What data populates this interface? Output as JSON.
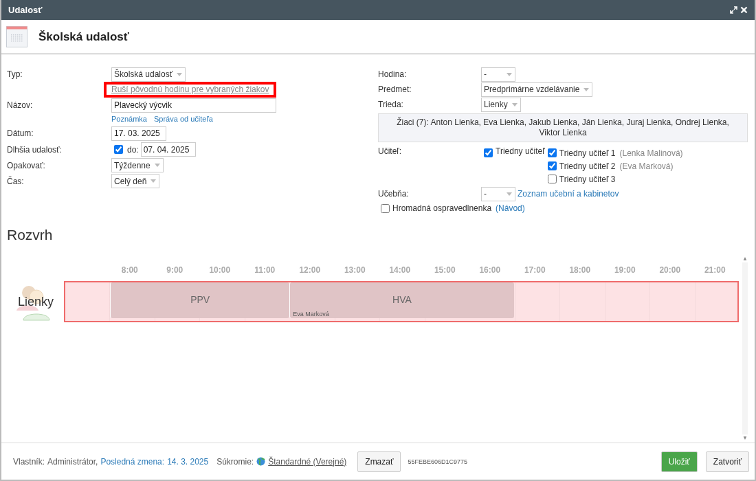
{
  "window": {
    "title": "Udalosť"
  },
  "header": {
    "title": "Školská udalosť"
  },
  "left_form": {
    "type": {
      "label": "Typ:",
      "value": "Školská udalosť",
      "note": "Ruší pôvodnú hodinu pre vybraných žiakov",
      "note_highlighted": true
    },
    "name": {
      "label": "Názov:",
      "value": "Plavecký výcvik",
      "links": [
        "Poznámka",
        "Správa od učiteľa"
      ]
    },
    "date": {
      "label": "Dátum:",
      "value": "17. 03. 2025"
    },
    "longer": {
      "label": "Dlhšia udalosť:",
      "checked": true,
      "to_label": "do:",
      "to_value": "07. 04. 2025"
    },
    "repeat": {
      "label": "Opakovať:",
      "value": "Týždenne"
    },
    "time": {
      "label": "Čas:",
      "value": "Celý deň"
    }
  },
  "right_form": {
    "lesson": {
      "label": "Hodina:",
      "value": "-"
    },
    "subject": {
      "label": "Predmet:",
      "value": "Predprimárne vzdelávanie"
    },
    "class": {
      "label": "Trieda:",
      "value": "Lienky"
    },
    "students": "Žiaci (7): Anton Lienka, Eva Lienka, Jakub Lienka, Ján Lienka, Juraj Lienka, Ondrej Lienka, Viktor Lienka",
    "teacher": {
      "label": "Učiteľ:",
      "main": {
        "label": "Triedny učiteľ",
        "checked": true
      },
      "options": [
        {
          "label": "Triedny učiteľ 1",
          "person": "(Lenka Malinová)",
          "checked": true
        },
        {
          "label": "Triedny učiteľ 2",
          "person": "(Eva Marková)",
          "checked": true
        },
        {
          "label": "Triedny učiteľ 3",
          "checked": false
        }
      ]
    },
    "room": {
      "label": "Učebňa:",
      "value": "-",
      "link": "Zoznam učební a kabinetov"
    },
    "bulk_excuse": {
      "label": "Hromadná ospravedlnenka",
      "checked": false,
      "link": "(Návod)"
    }
  },
  "schedule": {
    "title": "Rozvrh",
    "hours": [
      "8:00",
      "9:00",
      "10:00",
      "11:00",
      "12:00",
      "13:00",
      "14:00",
      "15:00",
      "16:00",
      "17:00",
      "18:00",
      "19:00",
      "20:00",
      "21:00"
    ],
    "row": {
      "name": "Lienky",
      "highlighted": true,
      "slots": [
        {
          "kind": "free"
        },
        {
          "kind": "lesson_start",
          "label": "PPV"
        },
        {
          "kind": "lesson_continue"
        },
        {
          "kind": "lesson_continue"
        },
        {
          "kind": "lesson_continue"
        },
        {
          "kind": "lesson_start",
          "label": "HVA",
          "teacher": "Eva Marková"
        },
        {
          "kind": "lesson_continue"
        },
        {
          "kind": "lesson_continue"
        },
        {
          "kind": "lesson_continue"
        },
        {
          "kind": "lesson_continue"
        },
        {
          "kind": "free"
        },
        {
          "kind": "free"
        },
        {
          "kind": "free"
        },
        {
          "kind": "free"
        },
        {
          "kind": "free"
        }
      ]
    }
  },
  "footer": {
    "owner_label": "Vlastník:",
    "owner": "Administrátor,",
    "changed_label": "Posledná zmena:",
    "changed": "14. 3. 2025",
    "privacy_label": "Súkromie:",
    "privacy": "Štandardné (Verejné)",
    "delete": "Zmazať",
    "id": "55FEBE606D1C9775",
    "save": "Uložiť",
    "close": "Zatvoriť"
  }
}
